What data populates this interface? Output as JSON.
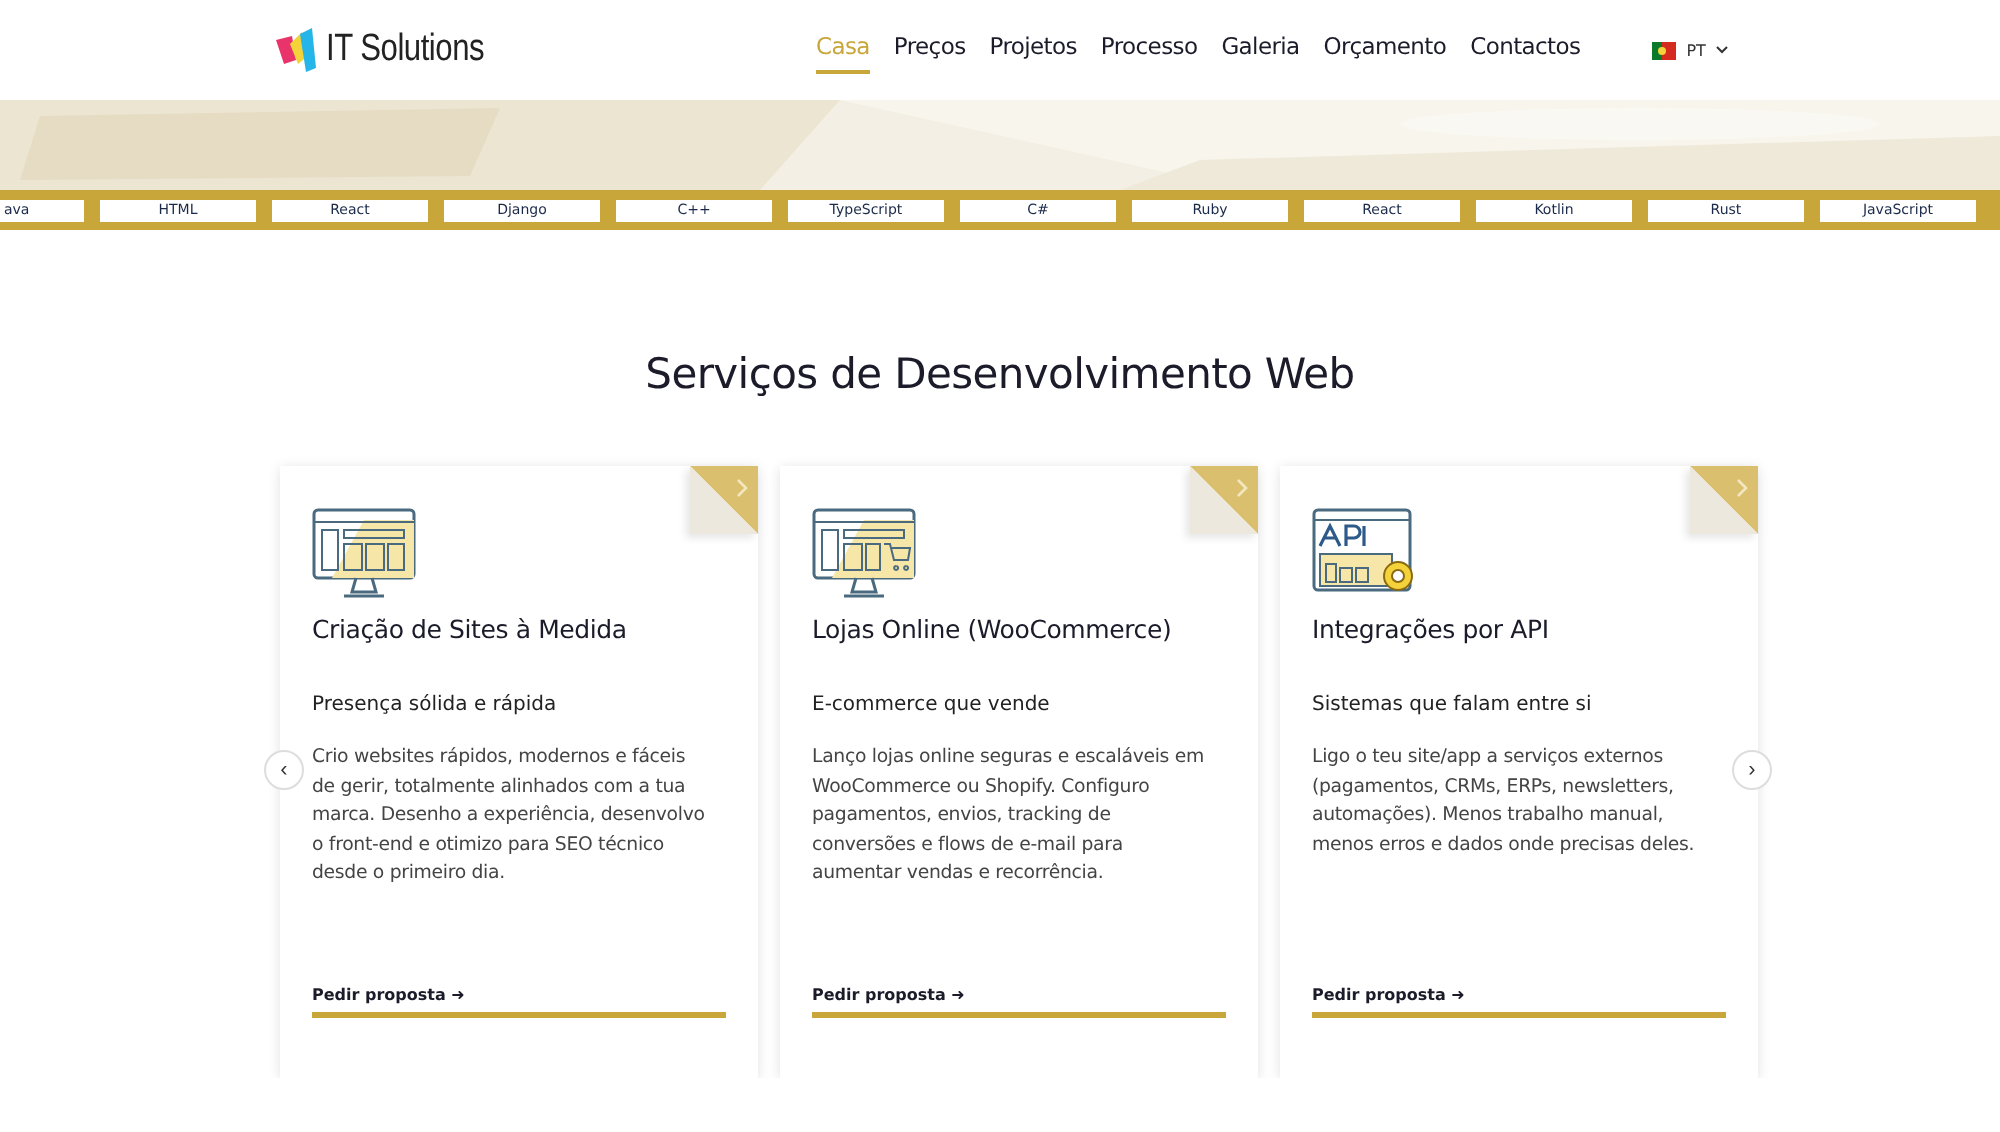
{
  "header": {
    "logo": "IT Solutions",
    "nav": [
      {
        "label": "Casa",
        "selected": true
      },
      {
        "label": "Preços",
        "selected": false
      },
      {
        "label": "Projetos",
        "selected": false
      },
      {
        "label": "Processo",
        "selected": false
      },
      {
        "label": "Galeria",
        "selected": false
      },
      {
        "label": "Orçamento",
        "selected": false
      },
      {
        "label": "Contactos",
        "selected": false
      }
    ],
    "language": "PT"
  },
  "tech_ticker": [
    "ava",
    "HTML",
    "React",
    "Django",
    "C++",
    "TypeScript",
    "C#",
    "Ruby",
    "React",
    "Kotlin",
    "Rust",
    "JavaScript"
  ],
  "services": {
    "title": "Serviços de Desenvolvimento Web",
    "prev": "‹",
    "next": "›",
    "cards": [
      {
        "kind": "website",
        "title": "Criação de Sites à Medida",
        "subtitle": "Presença sólida e rápida",
        "text": "Crio websites rápidos, modernos e fáceis de gerir, totalmente alinhados com a tua marca. Desenho a experiência, desenvolvo o front-end e otimizo para SEO técnico desde o primeiro dia.",
        "link": "Pedir proposta ➜"
      },
      {
        "kind": "shop",
        "title": "Lojas Online (WooCommerce)",
        "subtitle": "E-commerce que vende",
        "text": "Lanço lojas online seguras e escaláveis em WooCommerce ou Shopify. Configuro pagamentos, envios, tracking de conversões e flows de e-mail para aumentar vendas e recorrência.",
        "link": "Pedir proposta ➜"
      },
      {
        "kind": "api",
        "title": "Integrações por API",
        "subtitle": "Sistemas que falam entre si",
        "text": "Ligo o teu site/app a serviços externos (pagamentos, CRMs, ERPs, newsletters, automações). Menos trabalho manual, menos erros e dados onde precisas deles.",
        "link": "Pedir proposta ➜"
      }
    ]
  }
}
